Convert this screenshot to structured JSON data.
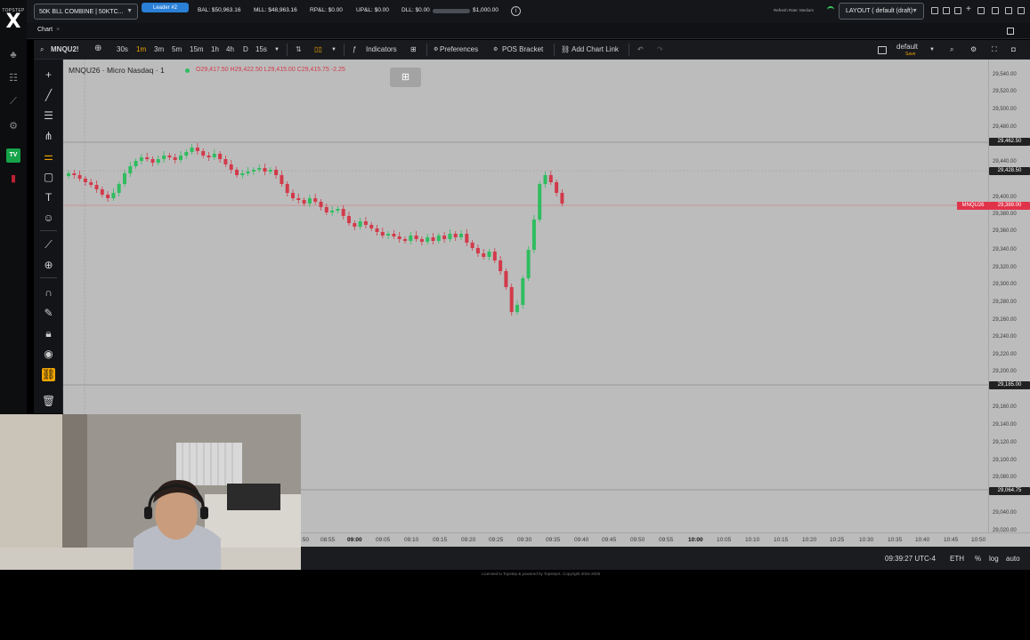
{
  "topbar": {
    "logo_small": "TOPSTEP",
    "logo_big": "X",
    "account": "50K BLL COMBINE | 50KTC...",
    "badge": "Leader #2",
    "stats": {
      "bal": "BAL: $50,963.16",
      "mll": "MLL: $48,963.16",
      "rpl": "RP&L: $0.00",
      "upl": "UP&L: $0.00",
      "dll": "DLL: $0.00",
      "dll_limit": "$1,000.00"
    },
    "refresh": "Refresh Rate: Medium",
    "layout": "LAYOUT ( default (draft)"
  },
  "tab": {
    "label": "Chart",
    "close": "×"
  },
  "toolbar": {
    "symbol": "MNQU2!",
    "timeframes": [
      "30s",
      "1m",
      "3m",
      "5m",
      "15m",
      "1h",
      "4h",
      "D",
      "15s"
    ],
    "active_timeframe": "1m",
    "indicators": "Indicators",
    "preferences": "Preferences",
    "pos_bracket": "POS Bracket",
    "add_chart_link": "Add Chart Link",
    "template_name": "default",
    "template_sub": "Save"
  },
  "chart": {
    "title": "MNQU26 · Micro Nasdaq · 1",
    "ohlc": "O29,417.50 H29,422.50 L29,415.00 C29,415.75 -2.25",
    "prices": [
      "29,540.00",
      "29,520.00",
      "29,500.00",
      "29,480.00",
      "29,440.00",
      "29,400.00",
      "29,380.00",
      "29,360.00",
      "29,340.00",
      "29,320.00",
      "29,300.00",
      "29,280.00",
      "29,260.00",
      "29,240.00",
      "29,220.00",
      "29,200.00",
      "29,160.00",
      "29,140.00",
      "29,120.00",
      "29,100.00",
      "29,080.00",
      "29,040.00",
      "29,020.00"
    ],
    "price_tags": [
      {
        "text": "29,462.50",
        "color": "#222222"
      },
      {
        "text": "29,428.50",
        "color": "#222222"
      },
      {
        "text": "29,389.00",
        "color": "#e0334a",
        "symbol": "MNQU26"
      },
      {
        "text": "29,185.00",
        "color": "#222222"
      },
      {
        "text": "29,064.75",
        "color": "#222222"
      }
    ],
    "times": [
      ":50",
      "08:55",
      "09:00",
      "09:05",
      "09:10",
      "09:15",
      "09:20",
      "09:25",
      "09:30",
      "09:35",
      "09:40",
      "09:45",
      "09:50",
      "09:55",
      "10:00",
      "10:05",
      "10:10",
      "10:15",
      "10:20",
      "10:25",
      "10:30",
      "10:35",
      "10:40",
      "10:45",
      "10:50"
    ],
    "bold_times": [
      "09:00",
      "10:00"
    ],
    "up_color": "#2ebd5f",
    "down_color": "#d23a4a"
  },
  "bottom": {
    "clock": "09:39:27 UTC-4",
    "session": "ETH",
    "percent": "%",
    "log": "log",
    "auto": "auto"
  },
  "footer": {
    "text": "Licensed to Topstep & powered by TopstepX. Copyright 2024-2026"
  }
}
